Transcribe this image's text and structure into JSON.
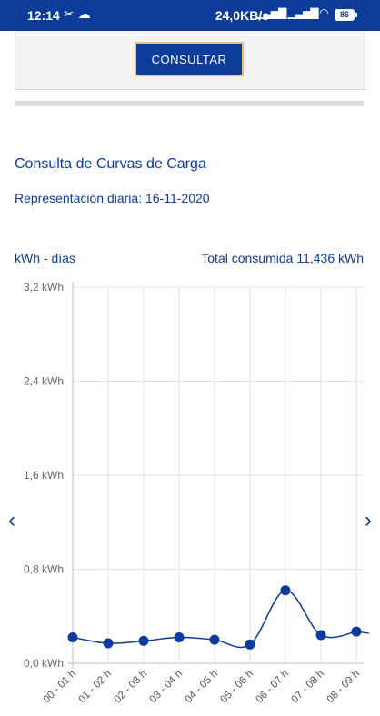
{
  "status_bar": {
    "time": "12:14",
    "speed": "24,0KB/s",
    "battery": "86"
  },
  "form": {
    "consult_label": "CONSULTAR"
  },
  "header": {
    "title": "Consulta de Curvas de Carga",
    "subtitle": "Representación diaria: 16-11-2020",
    "unit_label": "kWh - días",
    "total_label": "Total consumida  11,436 kWh"
  },
  "colors": {
    "brand": "#0d3b9a",
    "accent_border": "#e8c25a",
    "line": "#0d3b9a"
  },
  "icons": {
    "prev": "chevron-left-icon",
    "next": "chevron-right-icon"
  },
  "chart_data": {
    "type": "line",
    "categories": [
      "00 - 01 h",
      "01 - 02 h",
      "02 - 03 h",
      "03 - 04 h",
      "04 - 05 h",
      "05 - 06 h",
      "06 - 07 h",
      "07 - 08 h",
      "08 - 09 h"
    ],
    "values": [
      0.22,
      0.17,
      0.19,
      0.22,
      0.2,
      0.16,
      0.62,
      0.24,
      0.27
    ],
    "y_ticks": [
      "0,0 kWh",
      "0,8 kWh",
      "1,6 kWh",
      "2,4 kWh",
      "3,2 kWh"
    ],
    "ylim": [
      0,
      3.2
    ],
    "grid": true
  }
}
